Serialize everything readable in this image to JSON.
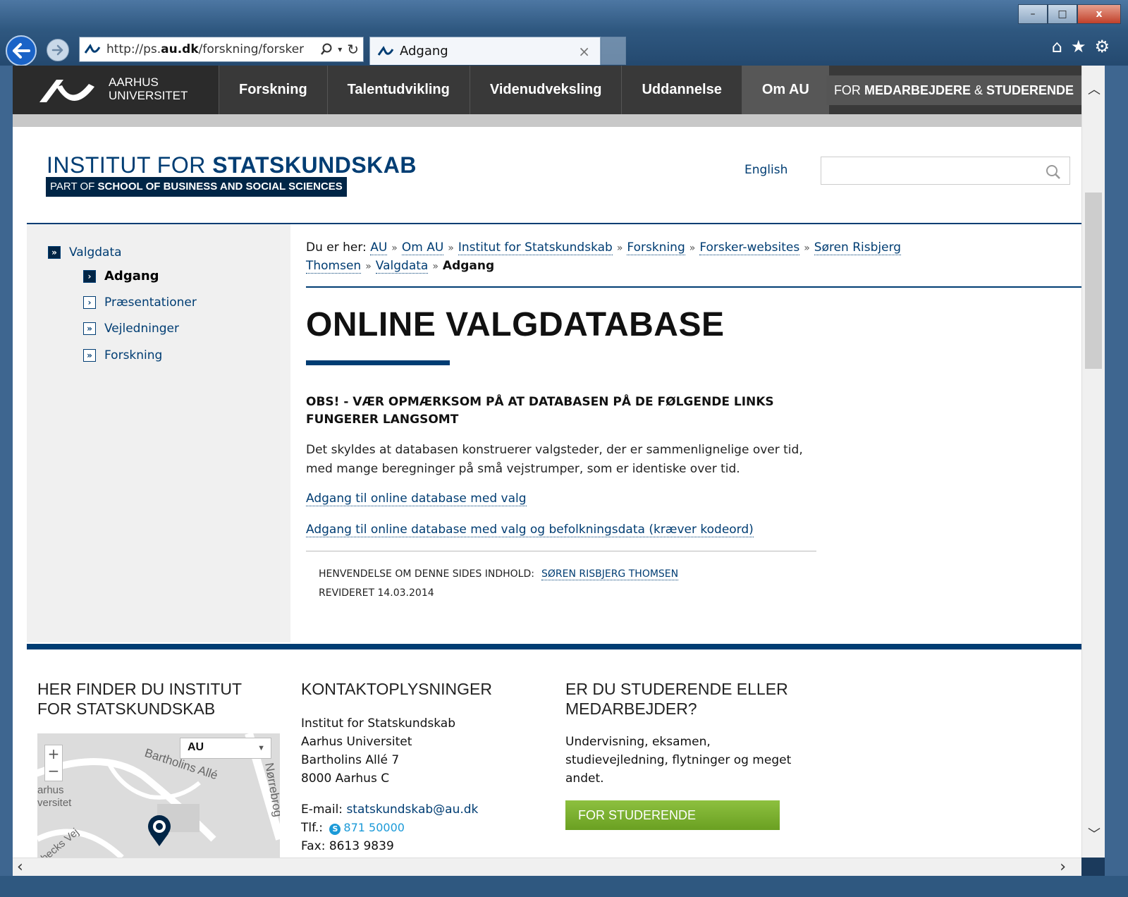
{
  "browser": {
    "url_prefix": "http://ps.",
    "url_domain": "au.dk",
    "url_rest": "/forskning/forsker",
    "tab_title": "Adgang",
    "tab_close": "×",
    "win_min": "–",
    "win_max": "□",
    "win_close": "x",
    "icon_home": "⌂",
    "icon_star": "★",
    "icon_gear": "⚙"
  },
  "au": {
    "logo_line1": "AARHUS",
    "logo_line2": "UNIVERSITET",
    "nav": [
      "Forskning",
      "Talentudvikling",
      "Videnudveksling",
      "Uddannelse",
      "Om AU"
    ],
    "staff_for": "FOR",
    "staff_medarbejdere": "MEDARBEJDERE",
    "staff_amp": "&",
    "staff_studerende": "STUDERENDE"
  },
  "dept": {
    "title_light": "INSTITUT FOR ",
    "title_bold": "STATSKUNDSKAB",
    "sub_light": "PART OF ",
    "sub_bold": "SCHOOL OF BUSINESS AND SOCIAL SCIENCES",
    "lang": "English"
  },
  "sidebar": {
    "items": [
      {
        "label": "Valgdata",
        "icon": "»"
      },
      {
        "label": "Adgang",
        "icon": "›"
      },
      {
        "label": "Præsentationer",
        "icon": "›"
      },
      {
        "label": "Vejledninger",
        "icon": "»"
      },
      {
        "label": "Forskning",
        "icon": "»"
      }
    ]
  },
  "breadcrumb": {
    "prefix": "Du er her:",
    "links": [
      "AU",
      "Om AU",
      "Institut for Statskundskab",
      "Forskning",
      "Forsker-websites",
      "Søren Risbjerg Thomsen",
      "Valgdata"
    ],
    "sep": "»",
    "current": "Adgang"
  },
  "content": {
    "title": "ONLINE VALGDATABASE",
    "notice": "OBS! - VÆR OPMÆRKSOM PÅ AT DATABASEN PÅ DE FØLGENDE LINKS FUNGERER LANGSOMT",
    "body": "Det skyldes at databasen konstruerer valgsteder, der er sammenlignelige over tid, med mange beregninger på små vejstrumper, som er identiske over tid.",
    "link1": "Adgang til online database med valg",
    "link2": "Adgang til online database med valg og befolkningsdata (kræver kodeord)",
    "meta_label": "HENVENDELSE OM DENNE SIDES INDHOLD:",
    "meta_person": "SØREN RISBJERG THOMSEN",
    "revised": "REVIDERET 14.03.2014"
  },
  "footer": {
    "col1_heading": "HER FINDER DU INSTITUT FOR STATSKUNDSKAB",
    "map_select": "AU",
    "map_labels": [
      "Bartholins Allé",
      "Nørrebrog",
      "arhus",
      "versitet",
      "becks Vej"
    ],
    "col2_heading": "KONTAKTOPLYSNINGER",
    "addr": [
      "Institut for Statskundskab",
      "Aarhus Universitet",
      "Bartholins Allé 7",
      "8000 Aarhus C"
    ],
    "email_label": "E-mail:",
    "email": "statskundskab@au.dk",
    "tel_label": "Tlf.:",
    "tel": "871 50000",
    "fax": "Fax: 8613 9839",
    "col3_heading": "ER DU STUDERENDE ELLER MEDARBEJDER?",
    "col3_text": "Undervisning, eksamen, studievejledning, flytninger og meget andet.",
    "students_button": "FOR STUDERENDE"
  },
  "colors": {
    "au_navy": "#003d73",
    "au_dark": "#393939",
    "green_button": "#7ab030"
  }
}
